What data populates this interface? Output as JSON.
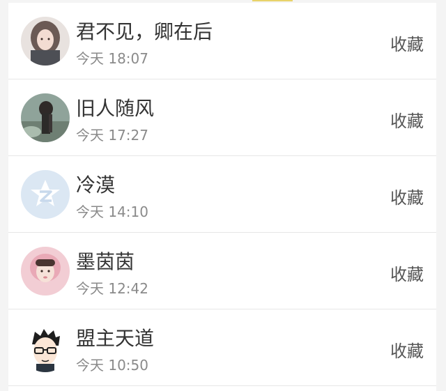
{
  "items": [
    {
      "name": "君不见，卿在后",
      "time": "今天 18:07",
      "action": "收藏",
      "avatar": "avatar-photo-woman-icon"
    },
    {
      "name": "旧人随风",
      "time": "今天 17:27",
      "action": "收藏",
      "avatar": "avatar-photo-landscape-icon"
    },
    {
      "name": "冷漠",
      "time": "今天 14:10",
      "action": "收藏",
      "avatar": "default-qzone-avatar-icon"
    },
    {
      "name": "墨茵茵",
      "time": "今天 12:42",
      "action": "收藏",
      "avatar": "avatar-photo-girl-pink-icon"
    },
    {
      "name": "盟主天道",
      "time": "今天 10:50",
      "action": "收藏",
      "avatar": "avatar-cartoon-glasses-icon"
    }
  ],
  "colors": {
    "background": "#f4f4f4",
    "card": "#ffffff",
    "name_text": "#333333",
    "time_text": "#8a8a8a",
    "action_text": "#555555",
    "divider": "#e6e6e6",
    "accent": "#e9d36a"
  }
}
